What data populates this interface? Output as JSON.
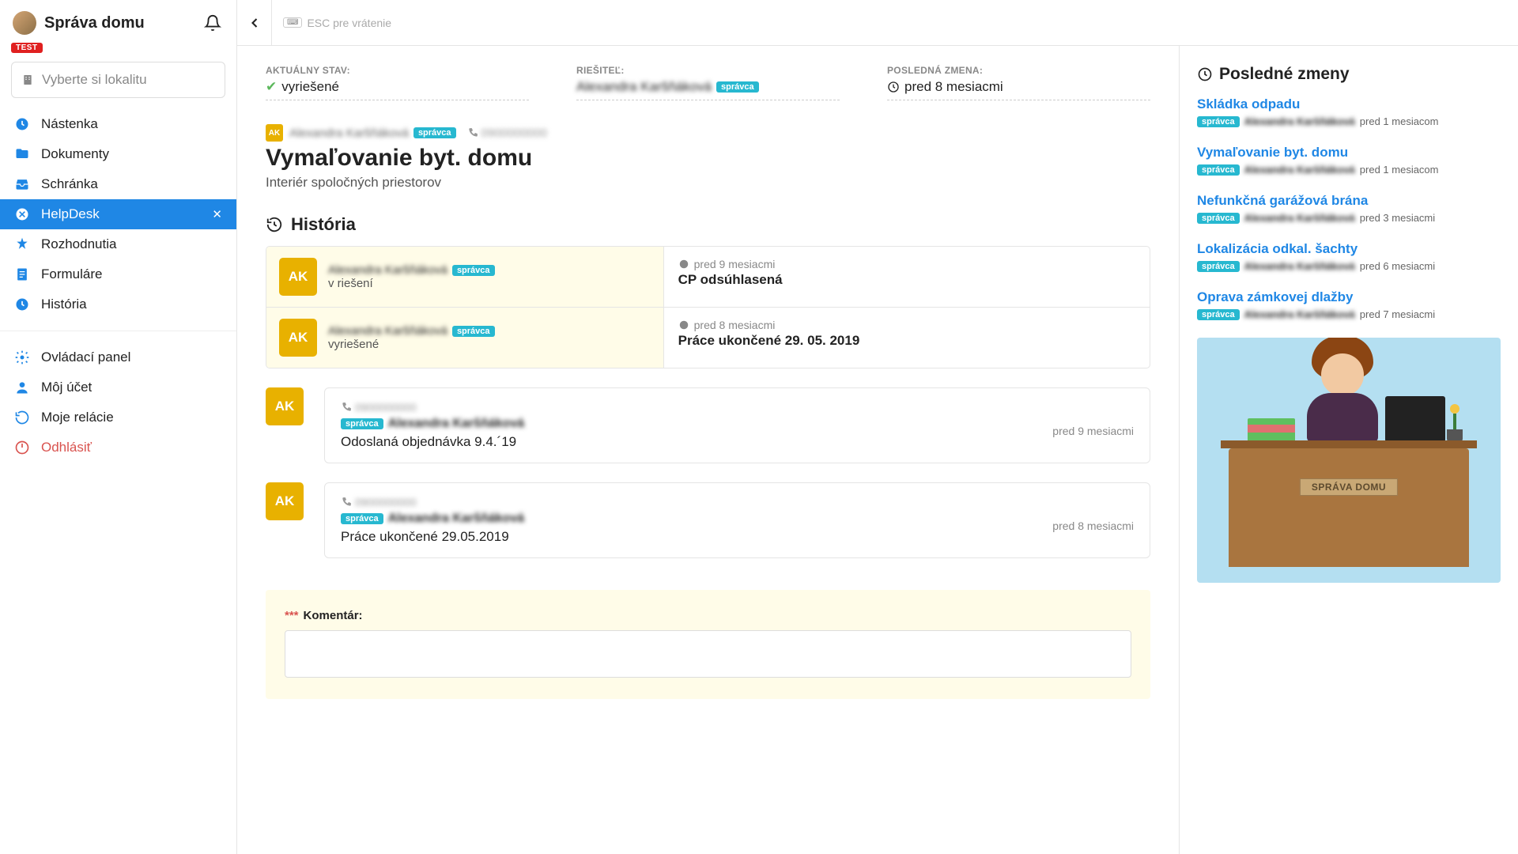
{
  "sidebar": {
    "app_title": "Správa domu",
    "test_badge": "TEST",
    "locality_placeholder": "Vyberte si lokalitu",
    "items": [
      {
        "label": "Nástenka"
      },
      {
        "label": "Dokumenty"
      },
      {
        "label": "Schránka"
      },
      {
        "label": "HelpDesk"
      },
      {
        "label": "Rozhodnutia"
      },
      {
        "label": "Formuláre"
      },
      {
        "label": "História"
      }
    ],
    "items2": [
      {
        "label": "Ovládací panel"
      },
      {
        "label": "Môj účet"
      },
      {
        "label": "Moje relácie"
      },
      {
        "label": "Odhlásiť"
      }
    ]
  },
  "topbar": {
    "esc_hint": "ESC pre vrátenie"
  },
  "status": {
    "label_state": "AKTUÁLNY STAV:",
    "state_value": "vyriešené",
    "label_assignee": "RIEŠITEĽ:",
    "assignee_name": "Alexandra Karšňáková",
    "assignee_badge": "správca",
    "label_changed": "POSLEDNÁ ZMENA:",
    "changed_value": "pred 8 mesiacmi"
  },
  "ticket": {
    "author_initials": "AK",
    "author_name": "Alexandra Karšňáková",
    "author_badge": "správca",
    "author_phone": "0900000000",
    "title": "Vymaľovanie byt. domu",
    "subtitle": "Interiér spoločných priestorov"
  },
  "history_header": "História",
  "history": [
    {
      "initials": "AK",
      "name": "Alexandra Karšňáková",
      "badge": "správca",
      "status": "v riešení",
      "time": "pred 9 mesiacmi",
      "desc": "CP odsúhlasená"
    },
    {
      "initials": "AK",
      "name": "Alexandra Karšňáková",
      "badge": "správca",
      "status": "vyriešené",
      "time": "pred 8 mesiacmi",
      "desc": "Práce ukončené 29. 05. 2019"
    }
  ],
  "comments": [
    {
      "initials": "AK",
      "phone": "0900000000",
      "badge": "správca",
      "name": "Alexandra Karšňáková",
      "msg": "Odoslaná objednávka 9.4.´19",
      "time": "pred 9 mesiacmi"
    },
    {
      "initials": "AK",
      "phone": "0900000000",
      "badge": "správca",
      "name": "Alexandra Karšňáková",
      "msg": "Práce ukončené 29.05.2019",
      "time": "pred 8 mesiacmi"
    }
  ],
  "new_comment": {
    "label": "Komentár:"
  },
  "right": {
    "header": "Posledné zmeny",
    "items": [
      {
        "title": "Skládka odpadu",
        "badge": "správca",
        "name": "Alexandra Karšňáková",
        "time": "pred 1 mesiacom"
      },
      {
        "title": "Vymaľovanie byt. domu",
        "badge": "správca",
        "name": "Alexandra Karšňáková",
        "time": "pred 1 mesiacom"
      },
      {
        "title": "Nefunkčná garážová brána",
        "badge": "správca",
        "name": "Alexandra Karšňáková",
        "time": "pred 3 mesiacmi"
      },
      {
        "title": "Lokalizácia odkal. šachty",
        "badge": "správca",
        "name": "Alexandra Karšňáková",
        "time": "pred 6 mesiacmi"
      },
      {
        "title": "Oprava zámkovej dlažby",
        "badge": "správca",
        "name": "Alexandra Karšňáková",
        "time": "pred 7 mesiacmi"
      }
    ],
    "desk_label": "SPRÁVA DOMU"
  }
}
